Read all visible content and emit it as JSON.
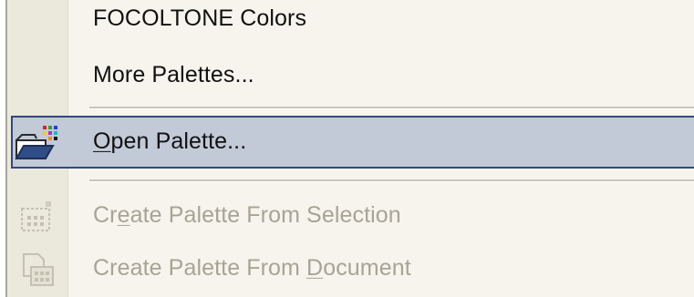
{
  "menu": {
    "items": [
      {
        "label": "FOCOLTONE Colors",
        "disabled": false
      },
      {
        "label": "More Palettes...",
        "disabled": false
      },
      {
        "label_pre": "",
        "label_key": "O",
        "label_post": "pen Palette...",
        "disabled": false,
        "highlighted": true,
        "icon": "open-folder-palette-icon"
      },
      {
        "label_pre": "Cr",
        "label_key": "e",
        "label_post": "ate Palette From Selection",
        "disabled": true,
        "icon": "palette-from-selection-icon"
      },
      {
        "label_pre": "Create Palette From ",
        "label_key": "D",
        "label_post": "ocument",
        "disabled": true,
        "icon": "palette-from-document-icon"
      }
    ]
  },
  "colors": {
    "highlight_bg": "#c2c9d7",
    "highlight_border": "#314a7b",
    "disabled_text": "#a7a496",
    "gutter": "#ebe8dc",
    "menu_bg": "#f6f4ec"
  }
}
